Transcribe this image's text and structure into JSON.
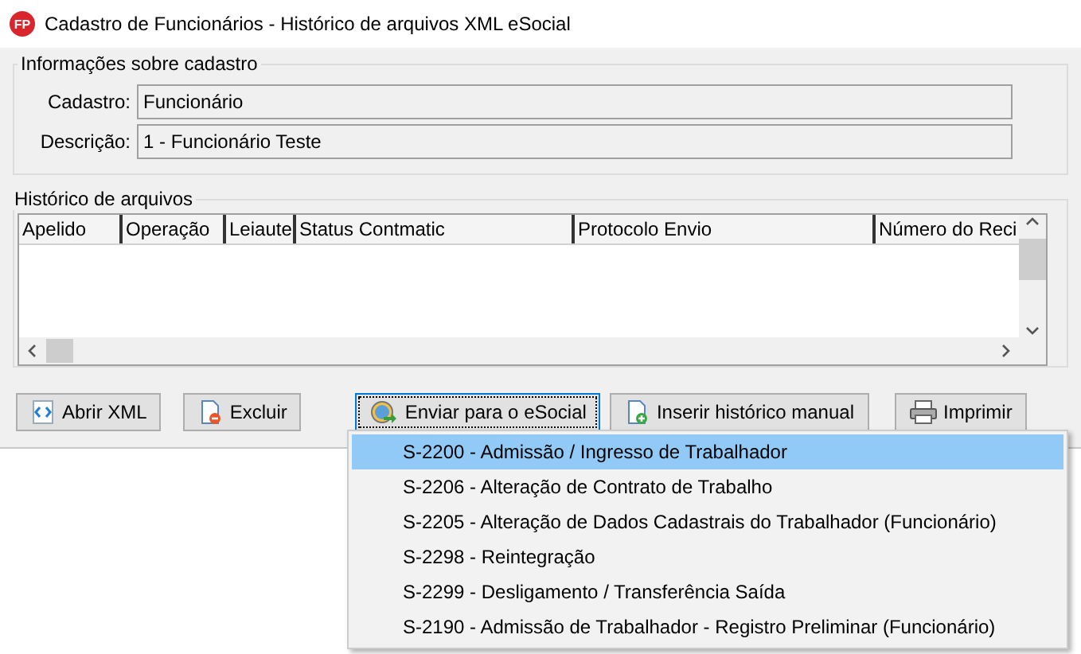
{
  "window": {
    "title": "Cadastro de Funcionários - Histórico de arquivos XML eSocial",
    "app_icon": "FP"
  },
  "info_group": {
    "title": "Informações sobre cadastro",
    "fields": [
      {
        "label": "Cadastro:",
        "value": "Funcionário"
      },
      {
        "label": "Descrição:",
        "value": "1 - Funcionário Teste"
      }
    ]
  },
  "history_group": {
    "title": "Histórico de arquivos",
    "columns": [
      "Apelido",
      "Operação",
      "Leiaute",
      "Status Contmatic",
      "Protocolo Envio",
      "Número do Reci"
    ]
  },
  "buttons": [
    {
      "label": "Abrir XML",
      "kind": "xml",
      "focused": false
    },
    {
      "label": "Excluir",
      "kind": "delete",
      "focused": false
    },
    {
      "label": "Enviar para o eSocial",
      "kind": "send",
      "focused": true
    },
    {
      "label": "Inserir histórico manual",
      "kind": "add",
      "focused": false
    },
    {
      "label": "Imprimir",
      "kind": "print",
      "focused": false
    }
  ],
  "dropdown_menu": [
    {
      "label": "S-2200 - Admissão / Ingresso de Trabalhador",
      "selected": true
    },
    {
      "label": "S-2206 - Alteração de Contrato de Trabalho",
      "selected": false
    },
    {
      "label": "S-2205 - Alteração de Dados Cadastrais do Trabalhador (Funcionário)",
      "selected": false
    },
    {
      "label": "S-2298 - Reintegração",
      "selected": false
    },
    {
      "label": "S-2299 - Desligamento / Transferência Saída",
      "selected": false
    },
    {
      "label": "S-2190 - Admissão de Trabalhador - Registro Preliminar (Funcionário)",
      "selected": false
    }
  ]
}
